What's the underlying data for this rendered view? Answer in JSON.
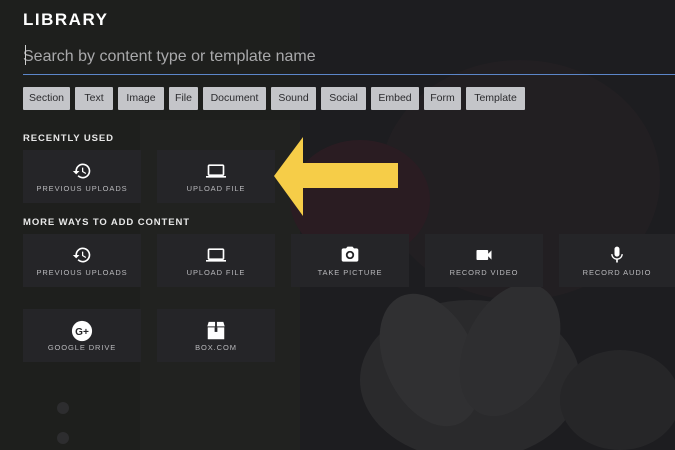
{
  "library_title": "LIBRARY",
  "search": {
    "placeholder": "Search by content type or template name"
  },
  "filters": [
    "Section",
    "Text",
    "Image",
    "File",
    "Document",
    "Sound",
    "Social",
    "Embed",
    "Form",
    "Template"
  ],
  "recently_used": {
    "heading": "RECENTLY USED",
    "tiles": [
      {
        "label": "PREVIOUS UPLOADS",
        "icon": "history-icon"
      },
      {
        "label": "UPLOAD FILE",
        "icon": "laptop-icon"
      }
    ]
  },
  "more_ways": {
    "heading": "MORE WAYS TO ADD CONTENT",
    "tiles": [
      {
        "label": "PREVIOUS UPLOADS",
        "icon": "history-icon"
      },
      {
        "label": "UPLOAD FILE",
        "icon": "laptop-icon"
      },
      {
        "label": "TAKE PICTURE",
        "icon": "camera-icon"
      },
      {
        "label": "RECORD VIDEO",
        "icon": "video-camera-icon"
      },
      {
        "label": "RECORD AUDIO",
        "icon": "microphone-icon"
      },
      {
        "label": "GOOGLE DRIVE",
        "icon": "google-plus-icon"
      },
      {
        "label": "BOX.COM",
        "icon": "box-icon"
      }
    ]
  },
  "colors": {
    "accent_underline": "#5c86c9",
    "arrow": "#f6cd48",
    "chip_bg": "#c4c5c9",
    "tile_bg": "#252528"
  }
}
